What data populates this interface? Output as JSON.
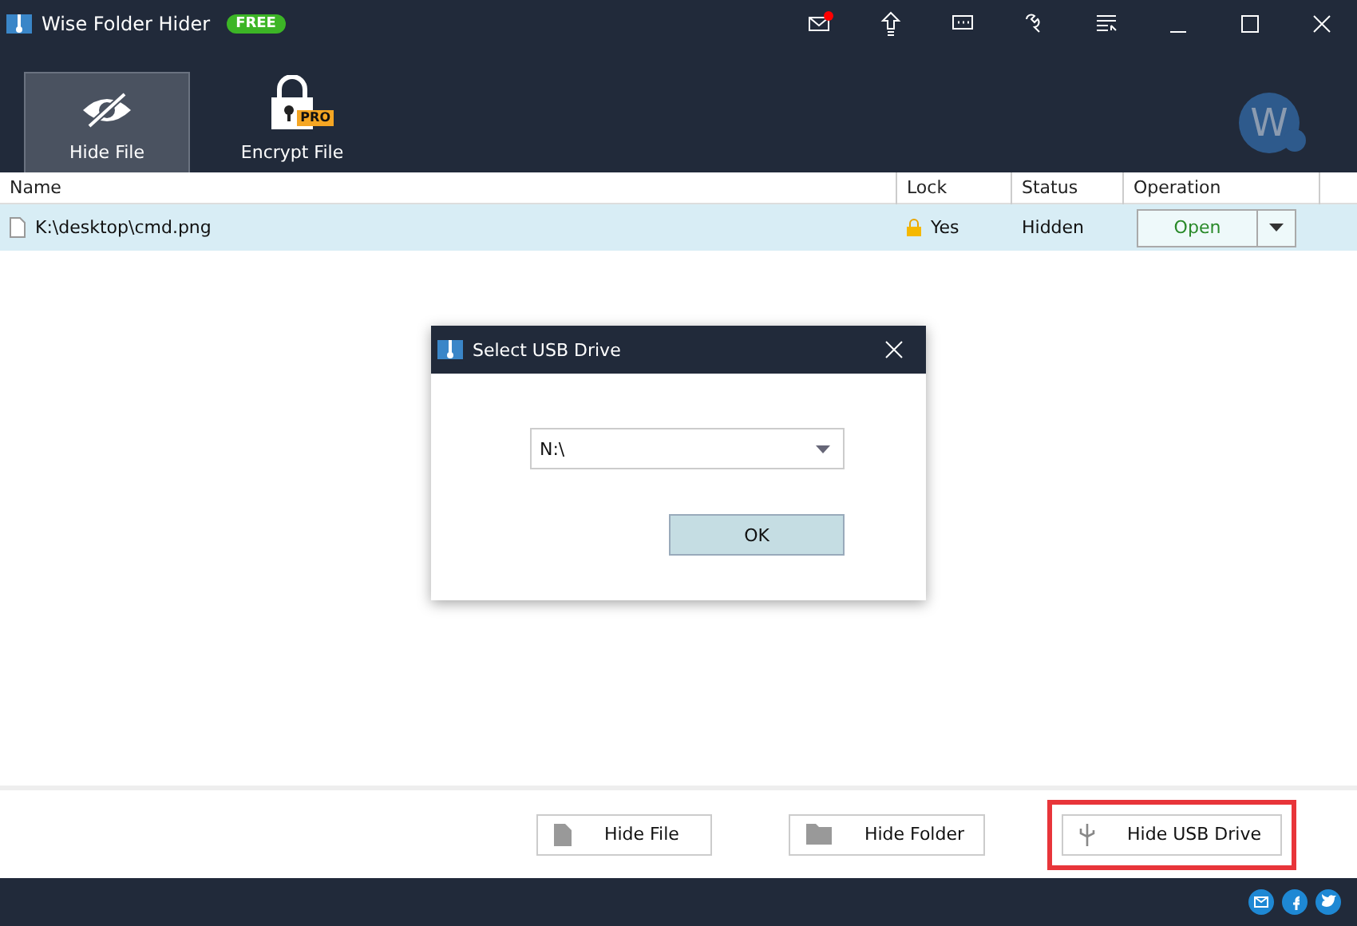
{
  "window": {
    "title": "Wise Folder Hider",
    "badge": "FREE"
  },
  "toolbar": [
    {
      "kind": "hide",
      "label": "Hide File",
      "selected": true
    },
    {
      "kind": "encrypt",
      "label": "Encrypt File",
      "selected": false,
      "badge": "PRO"
    }
  ],
  "logo": {
    "letter": "W"
  },
  "table": {
    "columns": [
      "Name",
      "Lock",
      "Status",
      "Operation"
    ],
    "rows": [
      {
        "name": "K:\\desktop\\cmd.png",
        "lock": "Yes",
        "status": "Hidden",
        "operation": "Open",
        "selected": true
      }
    ]
  },
  "dialog": {
    "title": "Select USB Drive",
    "drive": "N:\\",
    "ok": "OK"
  },
  "bottom_buttons": [
    {
      "kind": "file",
      "label": "Hide File",
      "highlighted": false
    },
    {
      "kind": "folder",
      "label": "Hide Folder",
      "highlighted": false
    },
    {
      "kind": "usb",
      "label": "Hide USB Drive",
      "highlighted": true
    }
  ]
}
